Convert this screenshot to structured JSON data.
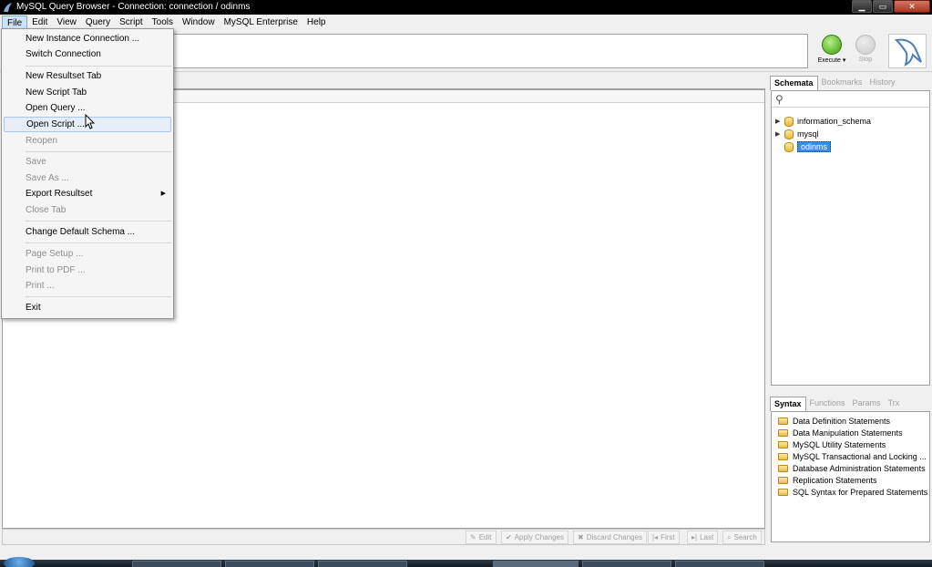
{
  "window": {
    "title": "MySQL Query Browser - Connection: connection / odinms",
    "controls": {
      "minimize": "▁",
      "maximize": "▭",
      "close": "✕"
    }
  },
  "menubar": {
    "items": [
      "File",
      "Edit",
      "View",
      "Query",
      "Script",
      "Tools",
      "Window",
      "MySQL Enterprise",
      "Help"
    ]
  },
  "toolbar": {
    "execute_label": "Execute ▾",
    "stop_label": "Stop"
  },
  "file_menu": {
    "items": [
      {
        "label": "New Instance Connection ...",
        "enabled": true
      },
      {
        "label": "Switch Connection",
        "enabled": true
      },
      {
        "label": "New Resultset Tab",
        "enabled": true
      },
      {
        "label": "New Script Tab",
        "enabled": true
      },
      {
        "label": "Open Query ...",
        "enabled": true
      },
      {
        "label": "Open Script ...",
        "enabled": true,
        "highlighted": true
      },
      {
        "label": "Reopen",
        "enabled": false
      },
      {
        "label": "Save",
        "enabled": false
      },
      {
        "label": "Save As ...",
        "enabled": false
      },
      {
        "label": "Export Resultset",
        "enabled": true,
        "submenu": true
      },
      {
        "label": "Close Tab",
        "enabled": false
      },
      {
        "label": "Change Default Schema ...",
        "enabled": true
      },
      {
        "label": "Page Setup ...",
        "enabled": false
      },
      {
        "label": "Print to PDF ...",
        "enabled": false
      },
      {
        "label": "Print ...",
        "enabled": false
      },
      {
        "label": "Exit",
        "enabled": true
      }
    ]
  },
  "result_toolbar": {
    "edit": "Edit",
    "apply": "Apply Changes",
    "discard": "Discard Changes",
    "first": "First",
    "last": "Last",
    "search": "Search"
  },
  "schemata_panel": {
    "tabs": [
      "Schemata",
      "Bookmarks",
      "History"
    ],
    "active_tab": "Schemata",
    "search_placeholder": "",
    "schemas": [
      {
        "name": "information_schema",
        "expandable": true
      },
      {
        "name": "mysql",
        "expandable": true
      },
      {
        "name": "odinms",
        "expandable": false,
        "selected": true
      }
    ]
  },
  "syntax_panel": {
    "tabs": [
      "Syntax",
      "Functions",
      "Params",
      "Trx"
    ],
    "active_tab": "Syntax",
    "items": [
      "Data Definition Statements",
      "Data Manipulation Statements",
      "MySQL Utility Statements",
      "MySQL Transactional and Locking ...",
      "Database Administration Statements",
      "Replication Statements",
      "SQL Syntax for Prepared Statements"
    ]
  },
  "colors": {
    "menu_highlight": "#cfe3f7",
    "selection": "#3d8ee0",
    "execute_green": "#3b9d0e"
  }
}
